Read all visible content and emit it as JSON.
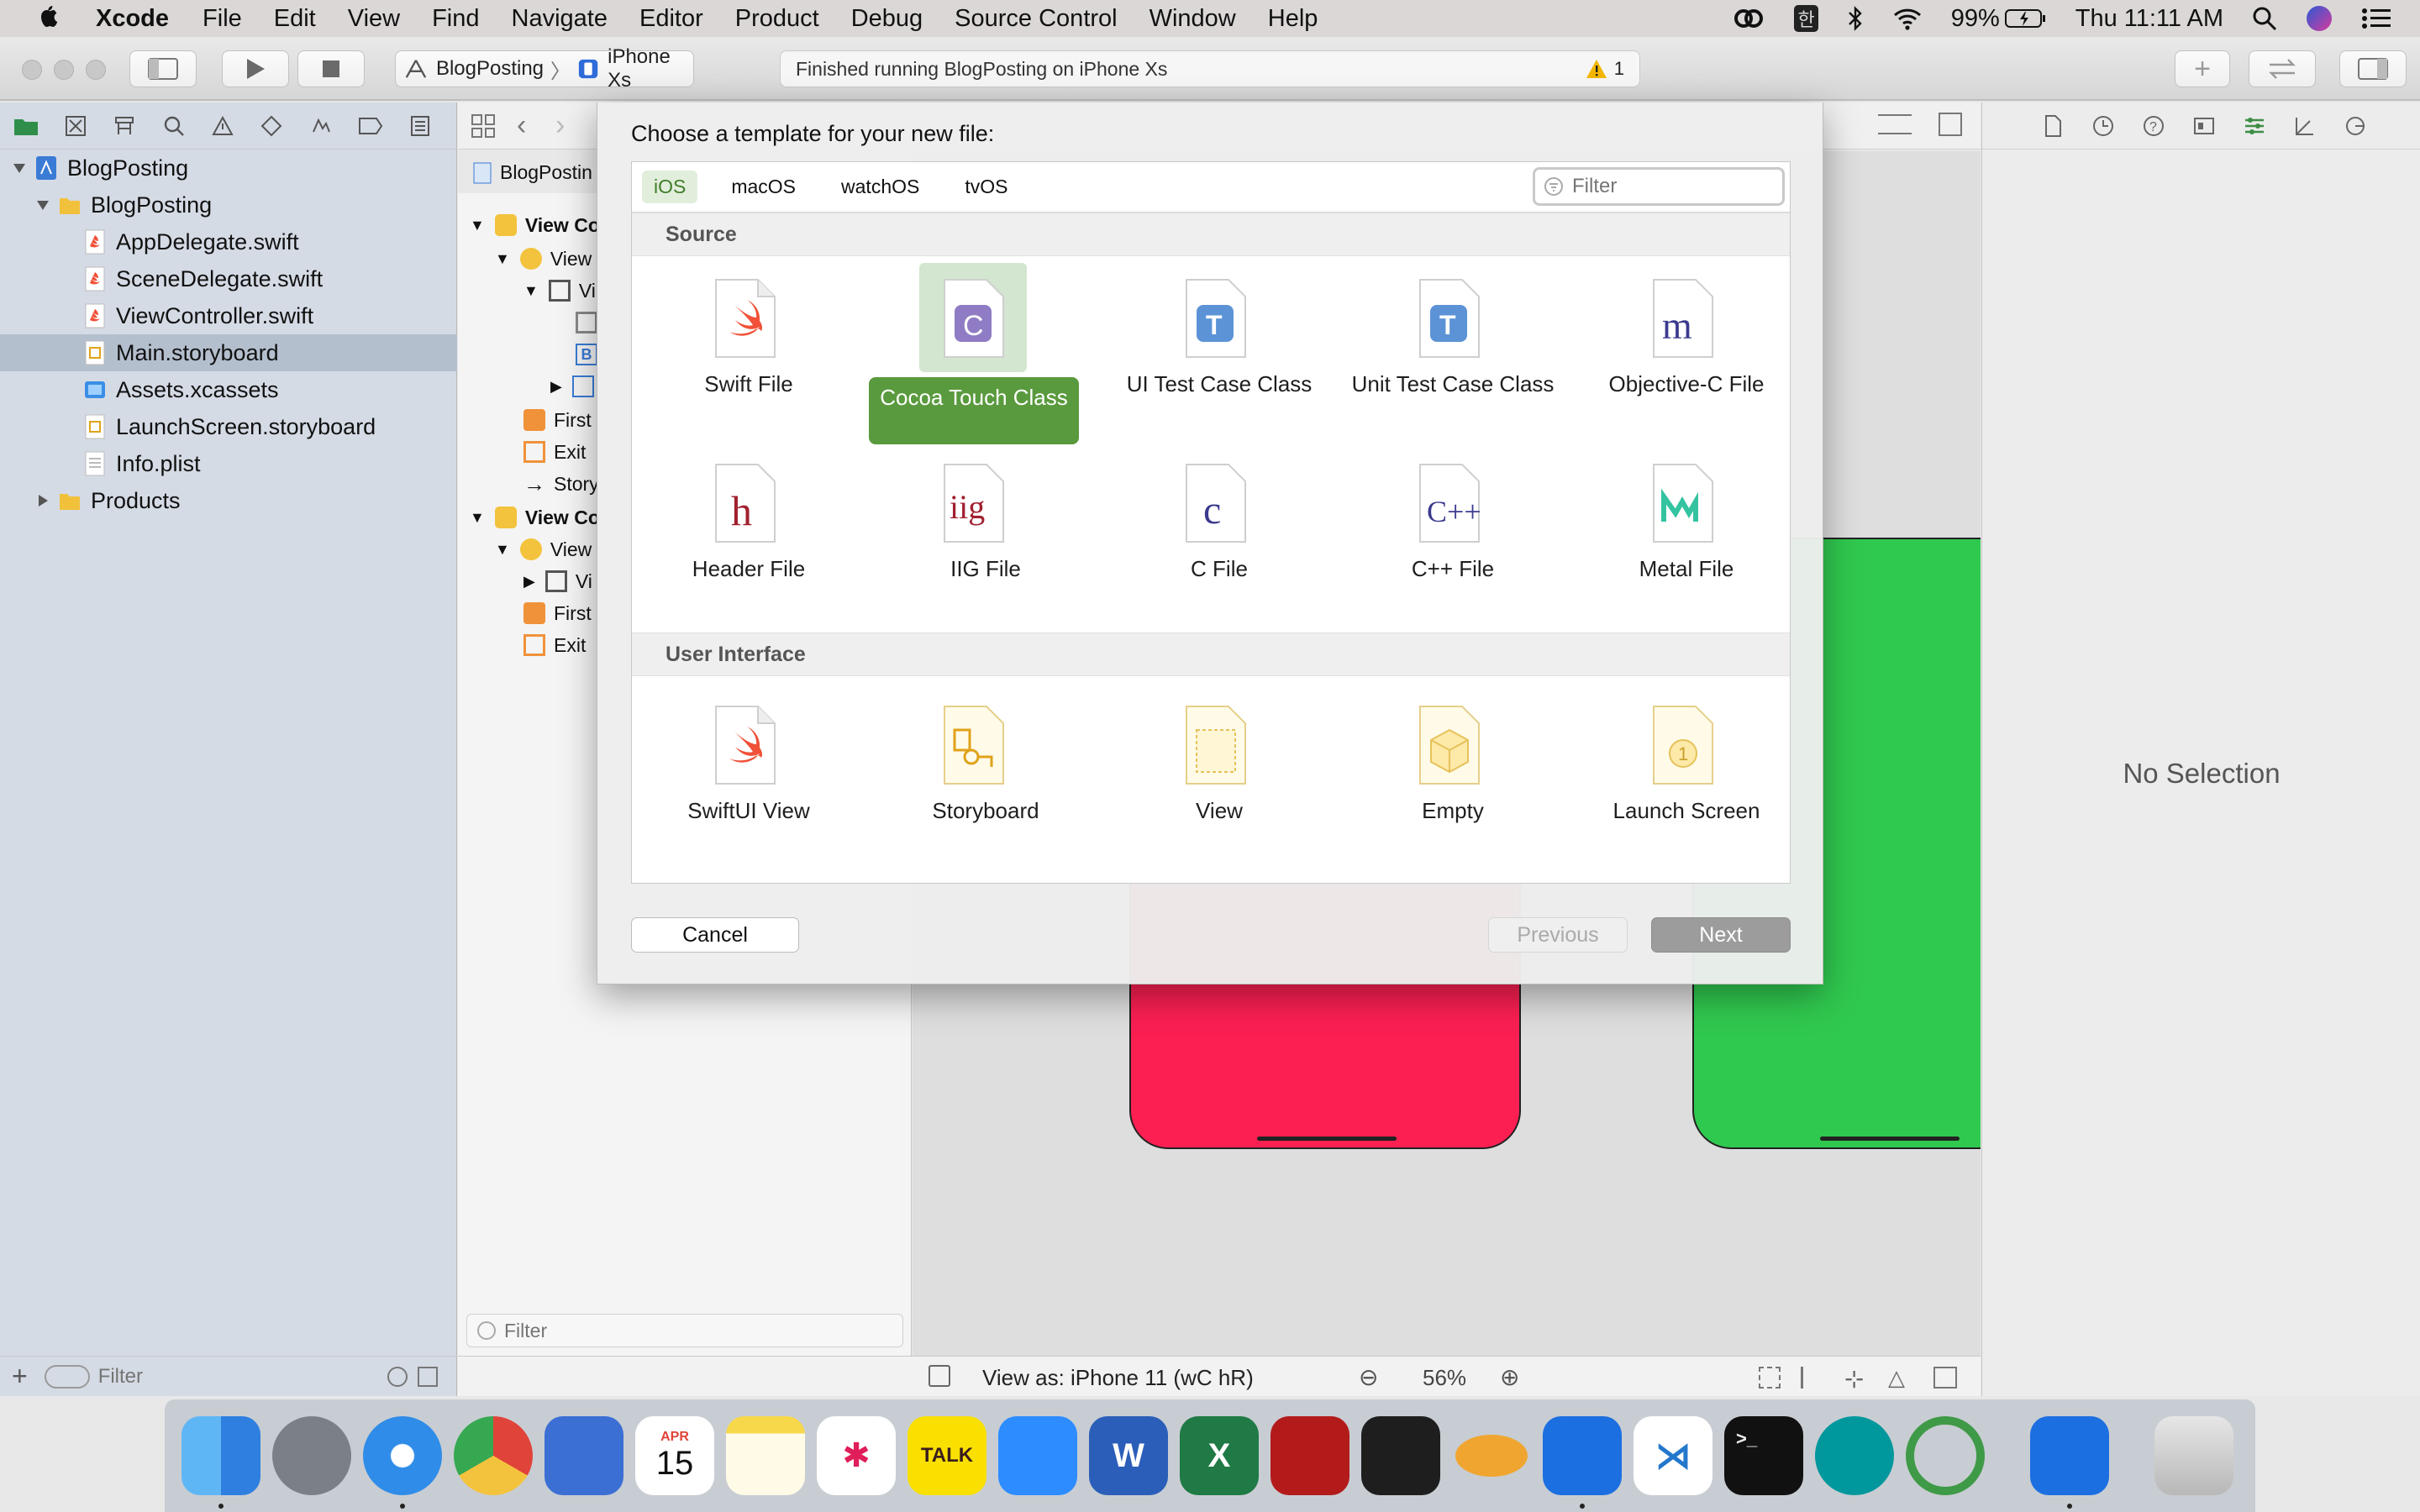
{
  "menubar": {
    "app": "Xcode",
    "items": [
      "File",
      "Edit",
      "View",
      "Find",
      "Navigate",
      "Editor",
      "Product",
      "Debug",
      "Source Control",
      "Window",
      "Help"
    ],
    "battery": "99%",
    "clock": "Thu 11:11 AM",
    "input_lang": "한"
  },
  "toolbar": {
    "scheme": "BlogPosting",
    "device": "iPhone Xs",
    "status": "Finished running BlogPosting on iPhone Xs",
    "warning_count": "1"
  },
  "navigator": {
    "items": [
      {
        "label": "BlogPosting",
        "kind": "project"
      },
      {
        "label": "BlogPosting",
        "kind": "folder"
      },
      {
        "label": "AppDelegate.swift",
        "kind": "swift"
      },
      {
        "label": "SceneDelegate.swift",
        "kind": "swift"
      },
      {
        "label": "ViewController.swift",
        "kind": "swift"
      },
      {
        "label": "Main.storyboard",
        "kind": "storyboard",
        "selected": true
      },
      {
        "label": "Assets.xcassets",
        "kind": "assets"
      },
      {
        "label": "LaunchScreen.storyboard",
        "kind": "storyboard"
      },
      {
        "label": "Info.plist",
        "kind": "plist"
      },
      {
        "label": "Products",
        "kind": "folder"
      }
    ],
    "filter_placeholder": "Filter"
  },
  "outline": {
    "jump_file": "BlogPostin",
    "rows": [
      "View Co",
      "View",
      "Vi",
      "",
      "B",
      "",
      "First",
      "Exit",
      "Story",
      "View Co",
      "View",
      "Vi",
      "First",
      "Exit"
    ],
    "filter_placeholder": "Filter"
  },
  "canvas": {
    "view_as": "View as: iPhone 11 (wC hR)",
    "zoom": "56%"
  },
  "inspector": {
    "no_selection": "No Selection"
  },
  "dialog": {
    "title": "Choose a template for your new file:",
    "platforms": [
      "iOS",
      "macOS",
      "watchOS",
      "tvOS"
    ],
    "active_platform": "iOS",
    "filter_placeholder": "Filter",
    "sections": [
      {
        "title": "Source",
        "templates": [
          {
            "label": "Swift File",
            "glyph": "swift-icon"
          },
          {
            "label": "Cocoa Touch Class",
            "glyph": "C",
            "selected": true
          },
          {
            "label": "UI Test Case Class",
            "glyph": "T"
          },
          {
            "label": "Unit Test Case Class",
            "glyph": "T"
          },
          {
            "label": "Objective-C File",
            "glyph": "m"
          },
          {
            "label": "Header File",
            "glyph": "h"
          },
          {
            "label": "IIG File",
            "glyph": "iig"
          },
          {
            "label": "C File",
            "glyph": "c"
          },
          {
            "label": "C++ File",
            "glyph": "C++"
          },
          {
            "label": "Metal File",
            "glyph": "metal-icon"
          }
        ]
      },
      {
        "title": "User Interface",
        "templates": [
          {
            "label": "SwiftUI View",
            "glyph": "swift-icon"
          },
          {
            "label": "Storyboard",
            "glyph": "storyboard-icon"
          },
          {
            "label": "View",
            "glyph": "view-icon"
          },
          {
            "label": "Empty",
            "glyph": "empty-icon"
          },
          {
            "label": "Launch Screen",
            "glyph": "1"
          }
        ]
      }
    ],
    "buttons": {
      "cancel": "Cancel",
      "previous": "Previous",
      "next": "Next"
    }
  },
  "dock": {
    "calendar_month": "APR",
    "calendar_day": "15",
    "talk_label": "TALK"
  }
}
